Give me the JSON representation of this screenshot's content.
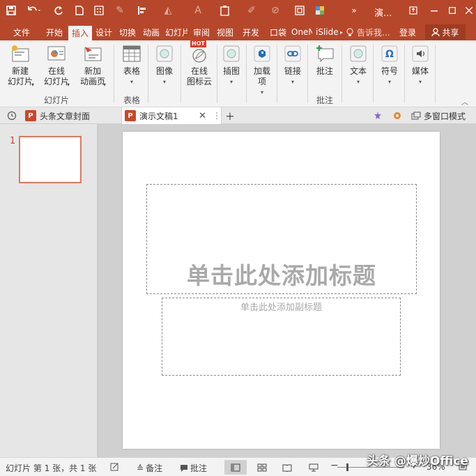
{
  "window": {
    "title": "演...",
    "accent": "#b7472a"
  },
  "quick_access": {
    "icons": [
      "save-icon",
      "undo-icon",
      "redo-icon",
      "new-file-icon",
      "touch-mode-icon",
      "pen-icon",
      "align-icon",
      "fill-icon",
      "font-color-icon",
      "clipboard-icon",
      "brush-icon",
      "eraser-icon",
      "frame-icon",
      "color-icon"
    ]
  },
  "tabs": [
    "文件",
    "开始",
    "插入",
    "设计",
    "切换",
    "动画",
    "幻灯片",
    "审阅",
    "视图",
    "开发",
    "口袋",
    "OneNote",
    "iSlide"
  ],
  "active_tab": "插入",
  "tell_me": "告诉我...",
  "login": "登录",
  "share": "共享",
  "ribbon": {
    "new_slide": "新建\n幻灯片",
    "online_slide": "在线\n幻灯片",
    "new_anim_page": "新加\n动画页",
    "group_slides": "幻灯片",
    "table": "表格",
    "group_table": "表格",
    "image": "图像",
    "online_icon_cloud": "在线\n图标云",
    "hot_badge": "HOT",
    "illustration": "插图",
    "addins": "加载\n项",
    "link": "链接",
    "comment": "批注",
    "group_comment": "批注",
    "text": "文本",
    "symbol": "符号",
    "media": "媒体"
  },
  "doc_tabs": {
    "tab1": "头条文章封面",
    "tab2": "演示文稿1",
    "multi_window": "多窗口模式"
  },
  "thumbnails": {
    "slide_number": "1"
  },
  "slide": {
    "title_placeholder": "单击此处添加标题",
    "subtitle_placeholder": "单击此处添加副标题"
  },
  "status": {
    "slide_info": "幻灯片 第 1 张，共 1 张",
    "notes": "备注",
    "comments": "批注",
    "zoom": "36%"
  },
  "watermark": "头条 @爆炒Office"
}
